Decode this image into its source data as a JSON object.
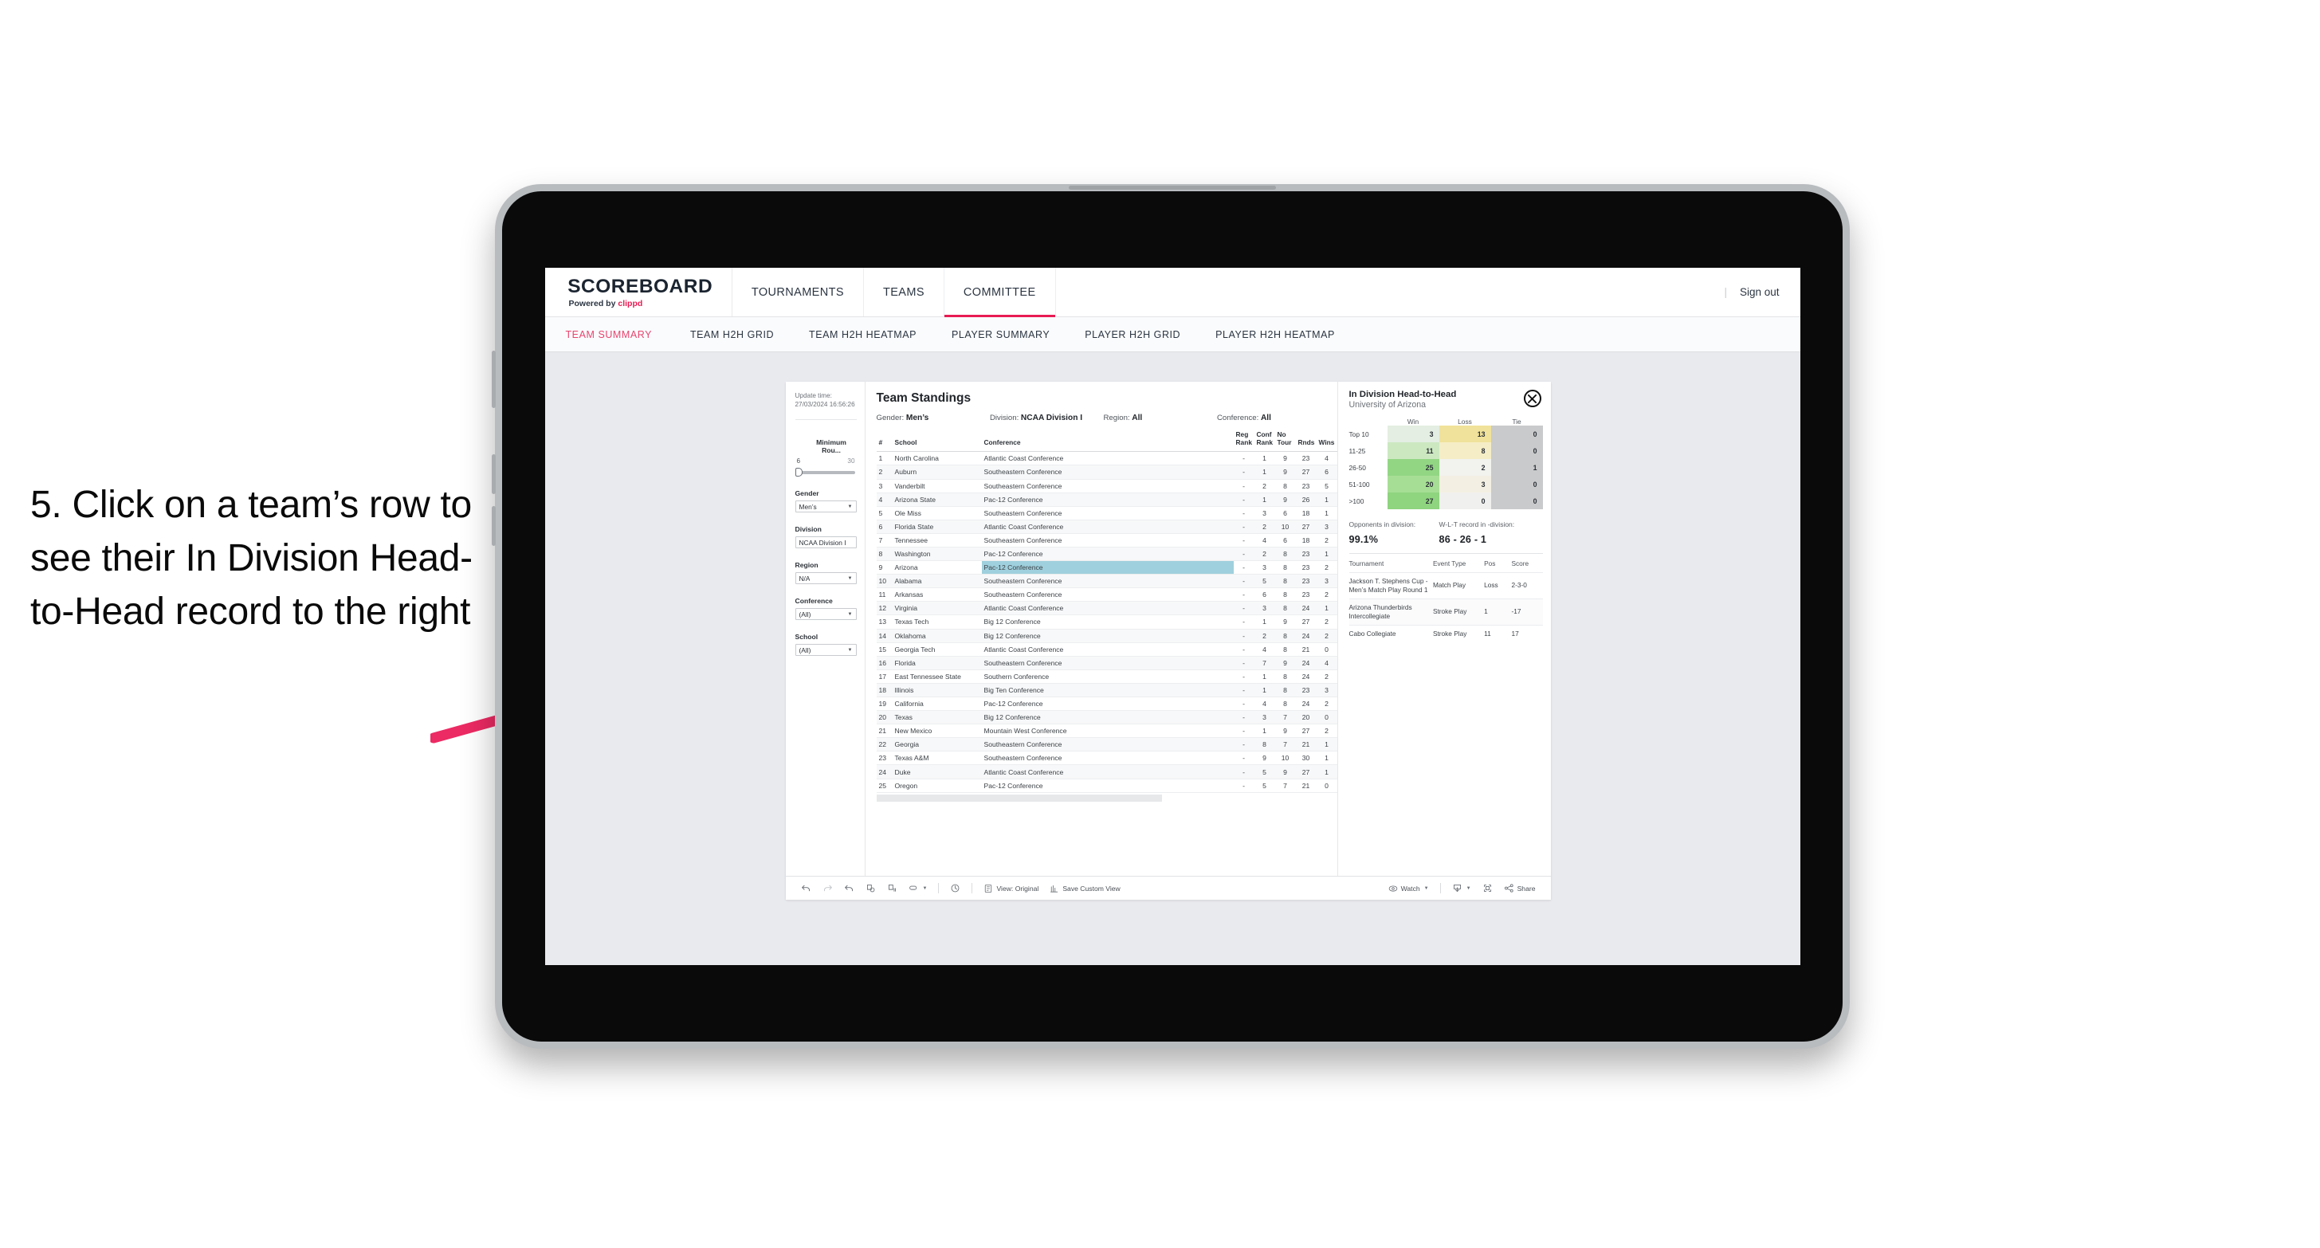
{
  "instruction": "5. Click on a team’s row to see their In Division Head-to-Head record to the right",
  "colors": {
    "accent": "#e81b52",
    "arrow": "#ec2a63",
    "selected_row": "#9fd0dd"
  },
  "header": {
    "brand_title": "SCOREBOARD",
    "brand_sub_prefix": "Powered by ",
    "brand_sub_name": "clippd",
    "nav": [
      {
        "label": "TOURNAMENTS",
        "active": false
      },
      {
        "label": "TEAMS",
        "active": false
      },
      {
        "label": "COMMITTEE",
        "active": true
      }
    ],
    "signout": "Sign out",
    "divider": "|"
  },
  "subnav": [
    {
      "label": "TEAM SUMMARY",
      "active": true
    },
    {
      "label": "TEAM H2H GRID",
      "active": false
    },
    {
      "label": "TEAM H2H HEATMAP",
      "active": false
    },
    {
      "label": "PLAYER SUMMARY",
      "active": false
    },
    {
      "label": "PLAYER H2H GRID",
      "active": false
    },
    {
      "label": "PLAYER H2H HEATMAP",
      "active": false
    }
  ],
  "filters": {
    "update_label": "Update time:",
    "update_time": "27/03/2024 16:56:26",
    "slider": {
      "title": "Minimum Rou...",
      "min": "6",
      "max": "30"
    },
    "controls": [
      {
        "title": "Gender",
        "value": "Men’s"
      },
      {
        "title": "Division",
        "value": "NCAA Division I"
      },
      {
        "title": "Region",
        "value": "N/A"
      },
      {
        "title": "Conference",
        "value": "(All)"
      },
      {
        "title": "School",
        "value": "(All)"
      }
    ]
  },
  "standings": {
    "title": "Team Standings",
    "meta": [
      {
        "label": "Gender: ",
        "value": "Men’s"
      },
      {
        "label": "Division: ",
        "value": "NCAA Division I"
      },
      {
        "label": "Region: ",
        "value": "All"
      },
      {
        "label": "Conference: ",
        "value": "All"
      }
    ],
    "columns": [
      "#",
      "School",
      "Conference",
      "Reg Rank",
      "Conf Rank",
      "No Tour",
      "Rnds",
      "Wins"
    ],
    "rows": [
      {
        "n": "1",
        "school": "North Carolina",
        "conf": "Atlantic Coast Conference",
        "reg": "-",
        "crank": "1",
        "notour": "9",
        "rnds": "23",
        "wins": "4",
        "selected": false
      },
      {
        "n": "2",
        "school": "Auburn",
        "conf": "Southeastern Conference",
        "reg": "-",
        "crank": "1",
        "notour": "9",
        "rnds": "27",
        "wins": "6",
        "selected": false
      },
      {
        "n": "3",
        "school": "Vanderbilt",
        "conf": "Southeastern Conference",
        "reg": "-",
        "crank": "2",
        "notour": "8",
        "rnds": "23",
        "wins": "5",
        "selected": false
      },
      {
        "n": "4",
        "school": "Arizona State",
        "conf": "Pac-12 Conference",
        "reg": "-",
        "crank": "1",
        "notour": "9",
        "rnds": "26",
        "wins": "1",
        "selected": false
      },
      {
        "n": "5",
        "school": "Ole Miss",
        "conf": "Southeastern Conference",
        "reg": "-",
        "crank": "3",
        "notour": "6",
        "rnds": "18",
        "wins": "1",
        "selected": false
      },
      {
        "n": "6",
        "school": "Florida State",
        "conf": "Atlantic Coast Conference",
        "reg": "-",
        "crank": "2",
        "notour": "10",
        "rnds": "27",
        "wins": "3",
        "selected": false
      },
      {
        "n": "7",
        "school": "Tennessee",
        "conf": "Southeastern Conference",
        "reg": "-",
        "crank": "4",
        "notour": "6",
        "rnds": "18",
        "wins": "2",
        "selected": false
      },
      {
        "n": "8",
        "school": "Washington",
        "conf": "Pac-12 Conference",
        "reg": "-",
        "crank": "2",
        "notour": "8",
        "rnds": "23",
        "wins": "1",
        "selected": false
      },
      {
        "n": "9",
        "school": "Arizona",
        "conf": "Pac-12 Conference",
        "reg": "-",
        "crank": "3",
        "notour": "8",
        "rnds": "23",
        "wins": "2",
        "selected": true
      },
      {
        "n": "10",
        "school": "Alabama",
        "conf": "Southeastern Conference",
        "reg": "-",
        "crank": "5",
        "notour": "8",
        "rnds": "23",
        "wins": "3",
        "selected": false
      },
      {
        "n": "11",
        "school": "Arkansas",
        "conf": "Southeastern Conference",
        "reg": "-",
        "crank": "6",
        "notour": "8",
        "rnds": "23",
        "wins": "2",
        "selected": false
      },
      {
        "n": "12",
        "school": "Virginia",
        "conf": "Atlantic Coast Conference",
        "reg": "-",
        "crank": "3",
        "notour": "8",
        "rnds": "24",
        "wins": "1",
        "selected": false
      },
      {
        "n": "13",
        "school": "Texas Tech",
        "conf": "Big 12 Conference",
        "reg": "-",
        "crank": "1",
        "notour": "9",
        "rnds": "27",
        "wins": "2",
        "selected": false
      },
      {
        "n": "14",
        "school": "Oklahoma",
        "conf": "Big 12 Conference",
        "reg": "-",
        "crank": "2",
        "notour": "8",
        "rnds": "24",
        "wins": "2",
        "selected": false
      },
      {
        "n": "15",
        "school": "Georgia Tech",
        "conf": "Atlantic Coast Conference",
        "reg": "-",
        "crank": "4",
        "notour": "8",
        "rnds": "21",
        "wins": "0",
        "selected": false
      },
      {
        "n": "16",
        "school": "Florida",
        "conf": "Southeastern Conference",
        "reg": "-",
        "crank": "7",
        "notour": "9",
        "rnds": "24",
        "wins": "4",
        "selected": false
      },
      {
        "n": "17",
        "school": "East Tennessee State",
        "conf": "Southern Conference",
        "reg": "-",
        "crank": "1",
        "notour": "8",
        "rnds": "24",
        "wins": "2",
        "selected": false
      },
      {
        "n": "18",
        "school": "Illinois",
        "conf": "Big Ten Conference",
        "reg": "-",
        "crank": "1",
        "notour": "8",
        "rnds": "23",
        "wins": "3",
        "selected": false
      },
      {
        "n": "19",
        "school": "California",
        "conf": "Pac-12 Conference",
        "reg": "-",
        "crank": "4",
        "notour": "8",
        "rnds": "24",
        "wins": "2",
        "selected": false
      },
      {
        "n": "20",
        "school": "Texas",
        "conf": "Big 12 Conference",
        "reg": "-",
        "crank": "3",
        "notour": "7",
        "rnds": "20",
        "wins": "0",
        "selected": false
      },
      {
        "n": "21",
        "school": "New Mexico",
        "conf": "Mountain West Conference",
        "reg": "-",
        "crank": "1",
        "notour": "9",
        "rnds": "27",
        "wins": "2",
        "selected": false
      },
      {
        "n": "22",
        "school": "Georgia",
        "conf": "Southeastern Conference",
        "reg": "-",
        "crank": "8",
        "notour": "7",
        "rnds": "21",
        "wins": "1",
        "selected": false
      },
      {
        "n": "23",
        "school": "Texas A&M",
        "conf": "Southeastern Conference",
        "reg": "-",
        "crank": "9",
        "notour": "10",
        "rnds": "30",
        "wins": "1",
        "selected": false
      },
      {
        "n": "24",
        "school": "Duke",
        "conf": "Atlantic Coast Conference",
        "reg": "-",
        "crank": "5",
        "notour": "9",
        "rnds": "27",
        "wins": "1",
        "selected": false
      },
      {
        "n": "25",
        "school": "Oregon",
        "conf": "Pac-12 Conference",
        "reg": "-",
        "crank": "5",
        "notour": "7",
        "rnds": "21",
        "wins": "0",
        "selected": false
      }
    ]
  },
  "panel": {
    "title": "In Division Head-to-Head",
    "subtitle": "University of Arizona",
    "close_icon": "close-icon",
    "h2h_columns": [
      "Win",
      "Loss",
      "Tie"
    ],
    "h2h_rows": [
      {
        "label": "Top 10",
        "win": "3",
        "loss": "13",
        "tie": "0",
        "win_color": "#e4eee2",
        "loss_color": "#f0e29a",
        "tie_color": "#c9cacb"
      },
      {
        "label": "11-25",
        "win": "11",
        "loss": "8",
        "tie": "0",
        "win_color": "#cce8c1",
        "loss_color": "#f5edc6",
        "tie_color": "#c9cacb"
      },
      {
        "label": "26-50",
        "win": "25",
        "loss": "2",
        "tie": "1",
        "win_color": "#92d684",
        "loss_color": "#f2f2ee",
        "tie_color": "#c9cacb"
      },
      {
        "label": "51-100",
        "win": "20",
        "loss": "3",
        "tie": "0",
        "win_color": "#a7de95",
        "loss_color": "#f3efe2",
        "tie_color": "#c9cacb"
      },
      {
        "label": ">100",
        "win": "27",
        "loss": "0",
        "tie": "0",
        "win_color": "#8fd47f",
        "loss_color": "#f0f0ee",
        "tie_color": "#c9cacb"
      }
    ],
    "stats": [
      {
        "caption": "Opponents in division:",
        "value": "99.1%"
      },
      {
        "caption": "W-L-T record in -division:",
        "value": "86 - 26 - 1"
      }
    ],
    "tournament_columns": [
      "Tournament",
      "Event Type",
      "Pos",
      "Score"
    ],
    "tournament_rows": [
      {
        "tournament": "Jackson T. Stephens Cup - Men’s Match Play Round 1",
        "event": "Match Play",
        "pos": "Loss",
        "score": "2-3-0"
      },
      {
        "tournament": "Arizona Thunderbirds Intercollegiate",
        "event": "Stroke Play",
        "pos": "1",
        "score": "-17"
      },
      {
        "tournament": "Cabo Collegiate",
        "event": "Stroke Play",
        "pos": "11",
        "score": "17"
      }
    ]
  },
  "toolbar": {
    "view_label": "View: Original",
    "save_label": "Save Custom View",
    "watch_label": "Watch",
    "share_label": "Share"
  }
}
